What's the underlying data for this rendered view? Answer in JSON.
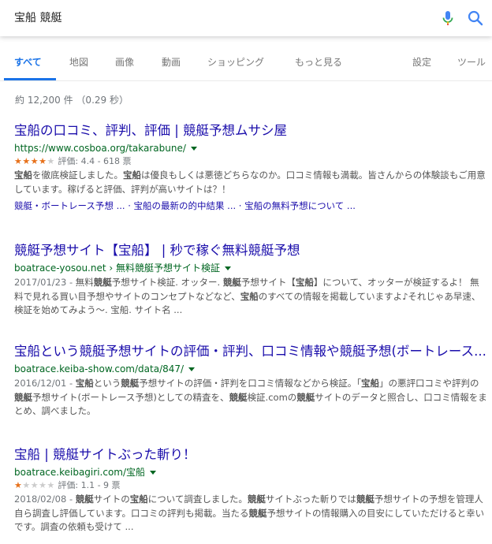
{
  "search": {
    "query": "宝船 競艇"
  },
  "tabs": [
    {
      "label": "すべて"
    },
    {
      "label": "地図"
    },
    {
      "label": "画像"
    },
    {
      "label": "動画"
    },
    {
      "label": "ショッピング"
    },
    {
      "label": "もっと見る"
    },
    {
      "label": "設定"
    },
    {
      "label": "ツール"
    }
  ],
  "stats": "約 12,200 件 （0.29 秒）",
  "results": [
    {
      "title": "宝船の口コミ、評判、評価 | 競艇予想ムサシ屋",
      "url": "https://www.cosboa.org/takarabune/",
      "stars": 4.4,
      "rating_text": "評価: 4.4 - 618 票",
      "snippet": [
        [
          "宝船",
          "b"
        ],
        [
          "を徹底検証しました。",
          ""
        ],
        [
          "宝船",
          "b"
        ],
        [
          "は優良もしくは悪徳どちらなのか。口コミ情報も満載。皆さんからの体験談もご用意しています。稼げると評価、評判が高いサイトは？！",
          ""
        ]
      ],
      "sitelinks": "競艇・ボートレース予想 ... · 宝船の最新の的中結果 ... · 宝船の無料予想について ..."
    },
    {
      "title": "競艇予想サイト【宝船】 | 秒で稼ぐ無料競艇予想",
      "url": "boatrace-yosou.net › 無料競艇予想サイト検証",
      "snippet": [
        [
          "2017/01/23 - ",
          "date"
        ],
        [
          "無料",
          ""
        ],
        [
          "競艇",
          "b"
        ],
        [
          "予想サイト検証. オッター. ",
          ""
        ],
        [
          "競艇",
          "b"
        ],
        [
          "予想サイト【",
          ""
        ],
        [
          "宝船",
          "b"
        ],
        [
          "】について、オッターが検証するよ！ 無料で見れる買い目予想やサイトのコンセプトなどなど、",
          ""
        ],
        [
          "宝船",
          "b"
        ],
        [
          "のすべての情報を掲載していますよ♪それじゃあ早速、検証を始めてみよう〜. 宝船. サイト名 ...",
          ""
        ]
      ]
    },
    {
      "title": "宝船という競艇予想サイトの評価・評判、口コミ情報や競艇予想(ボートレース...",
      "url": "boatrace.keiba-show.com/data/847/",
      "snippet": [
        [
          "2016/12/01 - ",
          "date"
        ],
        [
          "宝船",
          "b"
        ],
        [
          "という",
          ""
        ],
        [
          "競艇",
          "b"
        ],
        [
          "予想サイトの評価・評判を口コミ情報などから検証。「",
          ""
        ],
        [
          "宝船",
          "b"
        ],
        [
          "」の悪評口コミや評判の",
          ""
        ],
        [
          "競艇",
          "b"
        ],
        [
          "予想サイト(ボートレース予想)としての精査を、",
          ""
        ],
        [
          "競艇",
          "b"
        ],
        [
          "検証.comの",
          ""
        ],
        [
          "競艇",
          "b"
        ],
        [
          "サイトのデータと照合し、口コミ情報をまとめ、調べました。",
          ""
        ]
      ]
    },
    {
      "title": "宝船 | 競艇サイトぶった斬り！",
      "url": "boatrace.keibagiri.com/宝船",
      "stars": 1.1,
      "rating_text": "評価: 1.1 - 9 票",
      "snippet": [
        [
          "2018/02/08 - ",
          "date"
        ],
        [
          "競艇",
          "b"
        ],
        [
          "サイトの",
          ""
        ],
        [
          "宝船",
          "b"
        ],
        [
          "について調査しました。",
          ""
        ],
        [
          "競艇",
          "b"
        ],
        [
          "サイトぶった斬りでは",
          ""
        ],
        [
          "競艇",
          "b"
        ],
        [
          "予想サイトの予想を管理人自ら調査し評価しています。口コミの評判も掲載。当たる",
          ""
        ],
        [
          "競艇",
          "b"
        ],
        [
          "予想サイトの情報購入の目安にしていただけると幸いです。調査の依頼も受けて ...",
          ""
        ]
      ]
    }
  ],
  "colors": {
    "accent": "#1a73e8",
    "link": "#1a0dab",
    "url": "#006621",
    "star": "#e7711b"
  }
}
